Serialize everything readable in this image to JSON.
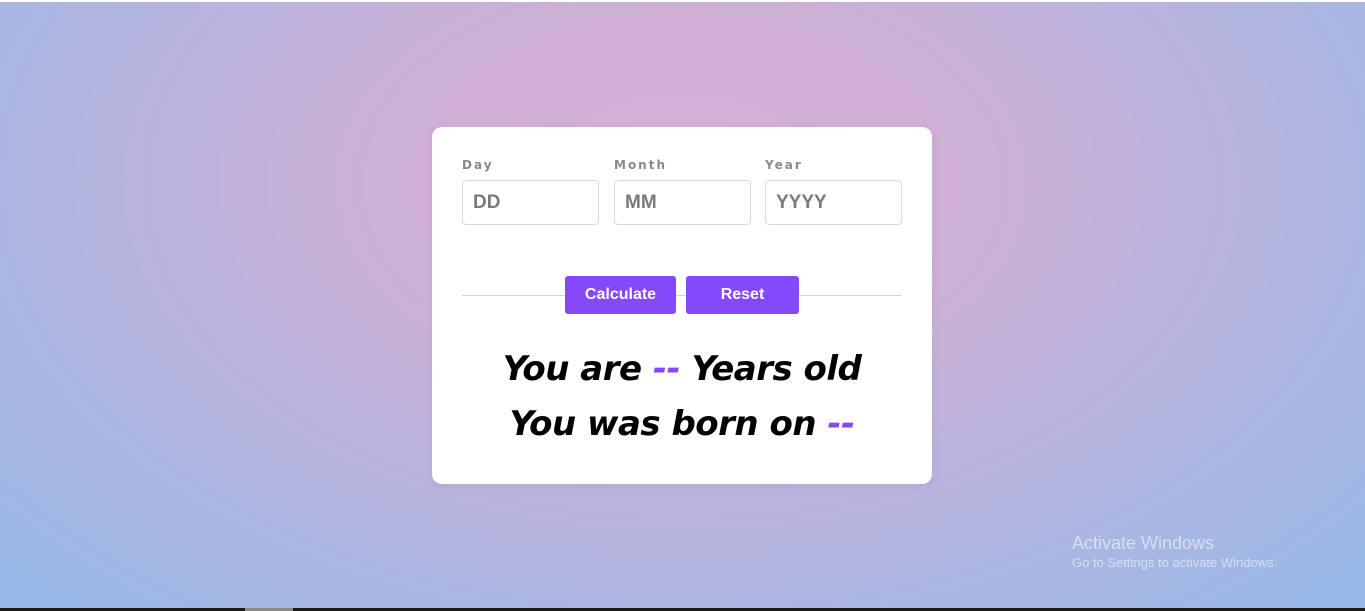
{
  "form": {
    "day": {
      "label": "Day",
      "placeholder": "DD"
    },
    "month": {
      "label": "Month",
      "placeholder": "MM"
    },
    "year": {
      "label": "Year",
      "placeholder": "YYYY"
    }
  },
  "buttons": {
    "calculate_label": "Calculate",
    "reset_label": "Reset"
  },
  "result": {
    "age_prefix": "You are",
    "age_value": "--",
    "age_suffix": "Years old",
    "born_prefix": "You was born on",
    "born_value": "--"
  },
  "watermark": {
    "title": "Activate Windows",
    "subtitle": "Go to Settings to activate Windows."
  },
  "colors": {
    "accent": "#8549fb",
    "card": "#ffffff",
    "label": "#8a8a8a"
  }
}
